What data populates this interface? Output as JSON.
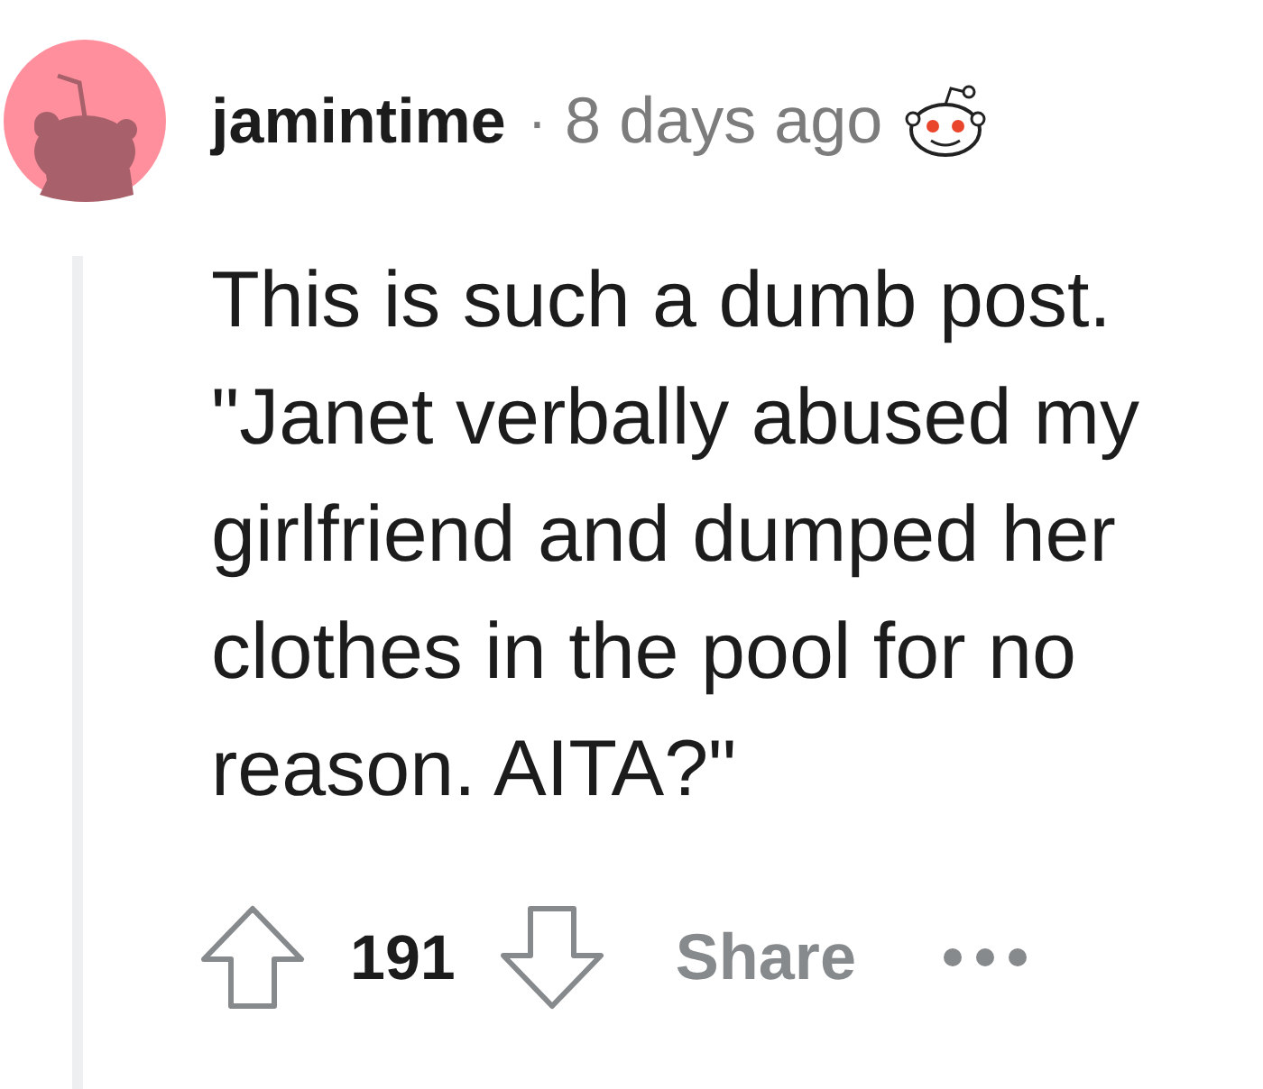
{
  "comment": {
    "username": "jamintime",
    "separator": "·",
    "timestamp": "8 days ago",
    "body": "This is such a dumb post. \"Janet verbally abused my girlfriend and dumped her clothes in the pool for no reason. AITA?\"",
    "score": "191",
    "actions": [
      {
        "kind": "share",
        "label": "Share"
      },
      {
        "kind": "more"
      }
    ]
  }
}
